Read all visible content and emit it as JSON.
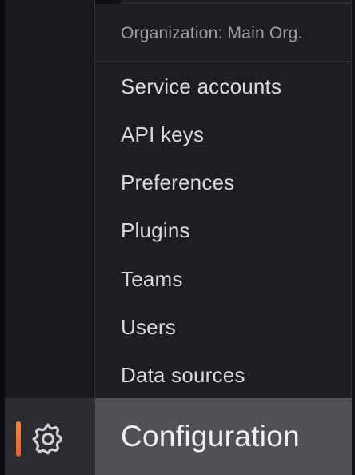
{
  "menu": {
    "header": "Organization: Main Org.",
    "items": [
      {
        "label": "Service accounts"
      },
      {
        "label": "API keys"
      },
      {
        "label": "Preferences"
      },
      {
        "label": "Plugins"
      },
      {
        "label": "Teams"
      },
      {
        "label": "Users"
      },
      {
        "label": "Data sources"
      }
    ],
    "footer_label": "Configuration"
  },
  "sidebar": {
    "active_item": {
      "icon": "gear-icon",
      "accent_color": "#f05a28"
    }
  },
  "colors": {
    "background": "#161719",
    "menu_background": "#1d1e22",
    "footer_background": "#505157",
    "text": "#d8d9de",
    "muted_text": "#9ea0a6"
  }
}
